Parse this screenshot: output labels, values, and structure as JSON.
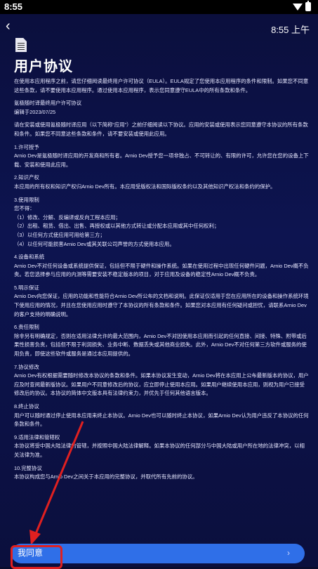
{
  "status": {
    "time": "8:55"
  },
  "header": {
    "clock": "8:55 上午",
    "title": "用户协议"
  },
  "intro": "在使用本应用程序之前，请您仔细阅读最终用户许可协议（EULA）。EULA规定了您使用本应用程序的条件和限制。如果您不同意这些条款，请不要使用本应用程序。通过使用本应用程序，表示您同意遵守EULA中的所有条款和条件。",
  "meta1": "氪极随时译最终用户许可协议",
  "meta2": "编辑于2023/07/25",
  "para1": "请在安装或使用氪极随时译应用（以下简称“应用”）之前仔细阅读以下协议。应用的安装或使用表示您同意遵守本协议的所有条款和条件。如果您不同意这些条款和条件，请不要安装或使用此应用。",
  "s1_title": "1.许可授予",
  "s1_body": "Arnio Dev是氪极随时译应用的开发商和所有者。Arnio Dev授予您一项非独占、不可转让的、有限的许可，允许您在您的设备上下载、安装和使用此应用。",
  "s2_title": "2.知识产权",
  "s2_body": "本应用的所有权和知识产权归Arnio Dev所有。本应用受版权法和国际版权条约以及其他知识产权法和条约的保护。",
  "s3_title": "3.使用限制",
  "s3_body": "您不得：",
  "s3_items": [
    "（1）修改、分解、反编译或反向工程本应用；",
    "（2）出租、租赁、借出、出售、再授权或以其他方式转让或分配本应用或其中任何权利；",
    "（3）以任何方式使应用可用给第三方；",
    "（4）以任何可能损害Arnio Dev或其关联公司声誉的方式使用本应用。"
  ],
  "s4_title": "4.设备和系统",
  "s4_body": "Arnio Dev不对任何设备或系统提供保证，包括但不限于硬件和操作系统。如果在使用过程中出现任何硬件问题，Arnio Dev概不负责。若您选择参与应用的内测等需要安装不稳定版本的项目，对于应用及设备的稳定性Arnio Dev概不负责。",
  "s5_title": "5.明示保证",
  "s5_body": "Arnio Dev向您保证，应用的功能和性能符合Arnio Dev所公布的文档和说明。此保证仅适用于您在应用所在的设备和操作系统环境下使用应用的情况，并且在您使用应用时遵守了本协议的所有条款和条件。如果您对本应用有任何疑问或担忧，请联系Arnio Dev的客户支持的明确说明。",
  "s6_title": "6.责任限制",
  "s6_body": "除非另有明确规定，否则在适用法律允许的最大范围内，Arnio Dev不对因使用本应用而引起的任何直接、间接、特殊、附带或后果性损害负责，包括但不限于利润损失、业务中断、数据丢失或其他商业损失。此外，Arnio Dev不对任何第三方软件或服务的使用负责，即使这些软件或服务是通过本应用提供的。",
  "s7_title": "7.协议修改",
  "s7_body": "Arnio Dev有权根据需要随时修改本协议的条款和条件。如果本协议发生变动，Arnio Dev将在本应用上公布最新版本的协议，用户应及时查阅最新版协议。如果用户不同意修改后的协议，应立即停止使用本应用。如果用户继续使用本应用，则视为用户已接受修改后的协议。本协议的简体中文版本具有法律约束力，并优先于任何其他语言版本。",
  "s8_title": "8.终止协议",
  "s8_body": "用户可以随时通过停止使用本应用来终止本协议。Arnio Dev也可以随时终止本协议，如果Arnio Dev认为用户违反了本协议的任何条款和条件。",
  "s9_title": "9.适用法律和管辖权",
  "s9_body": "本协议将受中国大陆法律的管辖，并按照中国大陆法律解释。如果本协议的任何部分与中国大陆或用户所在地的法律冲突，以相关法律为准。",
  "s10_title": "10.完整协议",
  "s10_body": "本协议构成您与Arnio Dev之间关于本应用的完整协议，并取代所有先前的协议。",
  "footer": {
    "agree_label": "我同意",
    "chevron": "›"
  },
  "colors": {
    "background": "#0b0f3d",
    "button": "#2f6fe8",
    "highlight": "#e02020"
  },
  "icons": {
    "back": "back-arrow-icon",
    "doc": "document-icon",
    "wifi": "wifi-icon",
    "battery": "battery-icon"
  }
}
